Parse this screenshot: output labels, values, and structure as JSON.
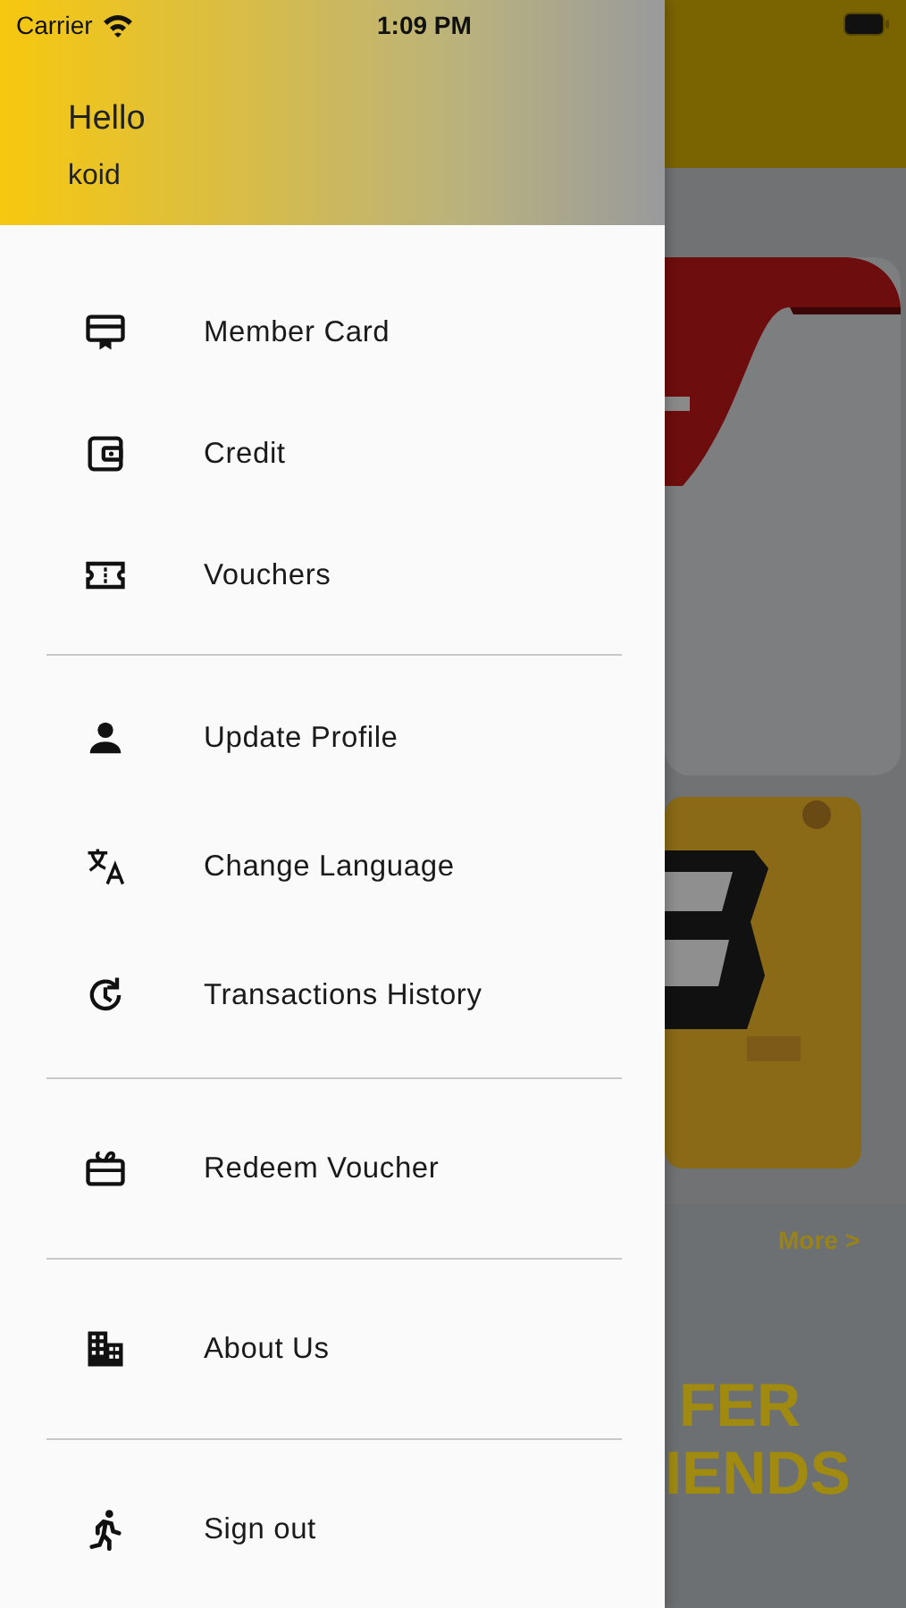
{
  "status_bar": {
    "carrier": "Carrier",
    "time": "1:09 PM"
  },
  "drawer": {
    "greeting": "Hello",
    "user": "koid",
    "sections": [
      [
        "Member Card",
        "Credit",
        "Vouchers"
      ],
      [
        "Update Profile",
        "Change Language",
        "Transactions History"
      ],
      [
        "Redeem Voucher"
      ],
      [
        "About Us"
      ],
      [
        "Sign out"
      ]
    ]
  },
  "background": {
    "more_link": "More >",
    "banner_lines": [
      "FER",
      "IENDS"
    ]
  }
}
